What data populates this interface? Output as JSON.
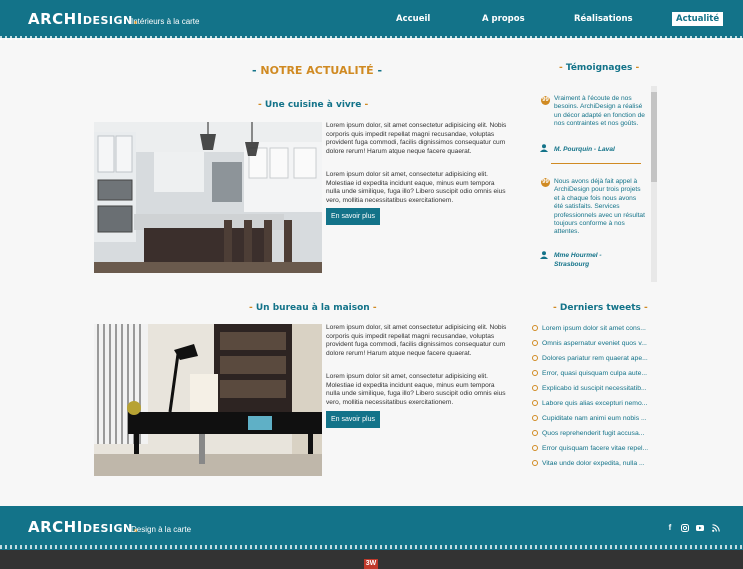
{
  "header": {
    "logo_archi": "ARCHI",
    "logo_design": "DESIGN",
    "logo_dot": ".",
    "tagline": "Intérieurs à la carte",
    "nav": [
      {
        "label": "Accueil"
      },
      {
        "label": "A propos"
      },
      {
        "label": "Réalisations"
      },
      {
        "label": "Actualité"
      }
    ]
  },
  "main": {
    "title": "NOTRE ACTUALITÉ",
    "articles": [
      {
        "title": "Une cuisine à vivre",
        "p1": "Lorem ipsum dolor, sit amet consectetur adipisicing elit. Nobis corporis quis impedit repellat magni recusandae, voluptas provident fuga commodi, facilis dignissimos consequatur cum dolore rerum! Harum atque neque facere quaerat.",
        "p2": "Lorem ipsum dolor sit amet, consectetur adipisicing elit. Molestiae id expedita incidunt eaque, minus eum tempora nulla unde similique, fuga illo? Libero suscipit odio omnis eius vero, mollitia necessitatibus exercitationem.",
        "button": "En savoir plus"
      },
      {
        "title": "Un bureau à la maison",
        "p1": "Lorem ipsum dolor, sit amet consectetur adipisicing elit. Nobis corporis quis impedit repellat magni recusandae, voluptas provident fuga commodi, facilis dignissimos consequatur cum dolore rerum! Harum atque neque facere quaerat.",
        "p2": "Lorem ipsum dolor sit amet, consectetur adipisicing elit. Molestiae id expedita incidunt eaque, minus eum tempora nulla unde similique, fuga illo? Libero suscipit odio omnis eius vero, mollitia necessitatibus exercitationem.",
        "button": "En savoir plus"
      }
    ]
  },
  "sidebar": {
    "testimonials_title": "Témoignages",
    "testimonials": [
      {
        "text": "Vraiment à l'écoute de nos besoins. ArchiDesign a réalisé un décor adapté en fonction de nos contraintes et nos goûts.",
        "author": "M. Pourquin - Laval"
      },
      {
        "text": "Nous avons déjà fait appel à ArchiDesign pour trois projets et à chaque fois nous avons été satisfaits. Services professionnels avec un résultat toujours conforme à nos attentes.",
        "author": "Mme Hourmel - Strasbourg"
      }
    ],
    "tweets_title": "Derniers tweets",
    "tweets": [
      "Lorem ipsum dolor sit amet cons...",
      "Omnis aspernatur eveniet quos v...",
      "Dolores pariatur rem quaerat ape...",
      "Error, quasi quisquam culpa aute...",
      "Explicabo id suscipit necessitatib...",
      "Labore quis alias excepturi nemo...",
      "Cupiditate nam animi eum nobis ...",
      "Quos reprehenderit fugit accusa...",
      "Error quisquam facere vitae repel...",
      "Vitae unde dolor expedita, nulla ..."
    ]
  },
  "footer": {
    "logo_archi": "ARCHI",
    "logo_design": "DESIGN",
    "logo_dot": ".",
    "tagline": "Design à la carte",
    "social": [
      "facebook-icon",
      "instagram-icon",
      "youtube-icon",
      "rss-icon"
    ],
    "badge": "3W"
  },
  "colors": {
    "primary": "#137389",
    "accent": "#d08a22",
    "bottom": "#333333"
  }
}
